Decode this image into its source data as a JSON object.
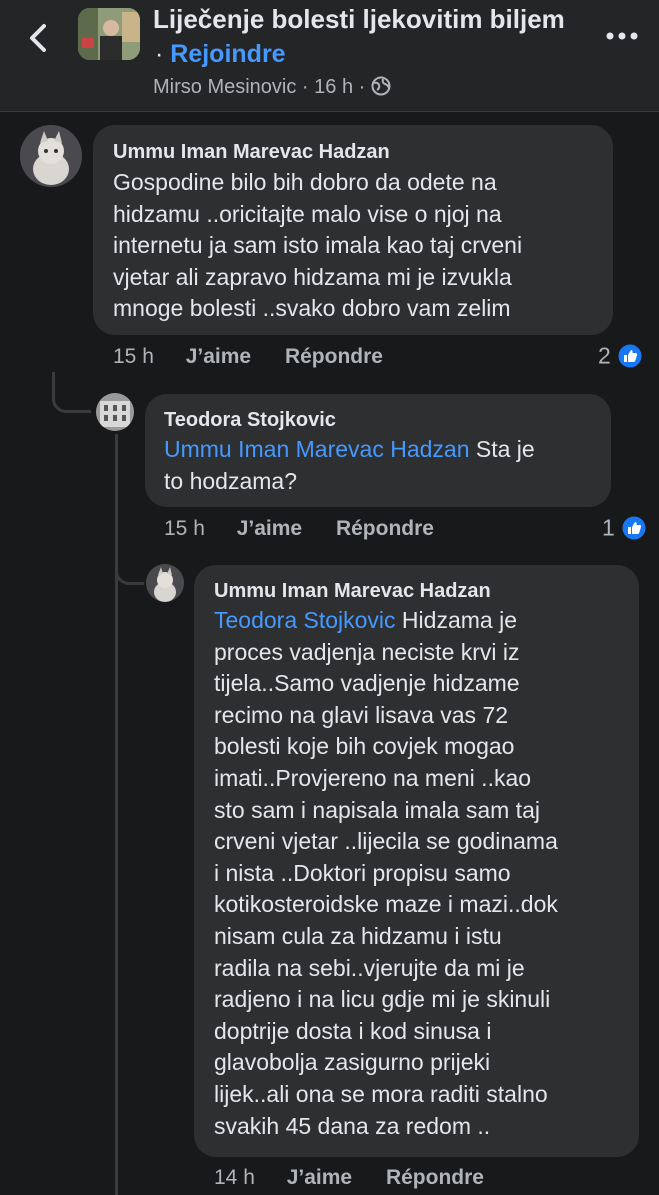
{
  "header": {
    "group_title": "Liječenje bolesti ljekovitim biljem",
    "separator": "·",
    "join_label": "Rejoindre",
    "author": "Mirso Mesinovic",
    "time": "16 h",
    "meta_sep": "·"
  },
  "comments": [
    {
      "author": "Ummu Iman Marevac Hadzan",
      "lines": [
        "Gospodine bilo bih dobro da odete na",
        "hidzamu ..oricitajte malo vise o njoj na",
        "internetu ja sam isto imala kao taj crveni",
        "vjetar ali zapravo hidzama mi je izvukla",
        "mnoge bolesti ..svako dobro vam zelim"
      ],
      "time": "15 h",
      "like_label": "J’aime",
      "reply_label": "Répondre",
      "reaction_count": "2"
    },
    {
      "author": "Teodora Stojkovic",
      "mention": "Ummu Iman Marevac Hadzan",
      "first_line_rest": " Sta je",
      "lines": [
        "to hodzama?"
      ],
      "time": "15 h",
      "like_label": "J’aime",
      "reply_label": "Répondre",
      "reaction_count": "1"
    },
    {
      "author": "Ummu Iman Marevac Hadzan",
      "mention": "Teodora Stojkovic",
      "first_line_rest": " Hidzama je",
      "lines": [
        "proces vadjenja neciste krvi iz",
        "tijela..Samo vadjenje hidzame",
        "recimo na glavi lisava vas 72",
        "bolesti koje bih covjek mogao",
        "imati..Provjereno na meni ..kao",
        "sto sam i napisala imala sam taj",
        "crveni vjetar ..lijecila se godinama",
        "i nista ..Doktori propisu samo",
        "kotikosteroidske maze i mazi..dok",
        "nisam cula za hidzamu i istu",
        "radila na sebi..vjerujte da mi je",
        "radjeno i na licu gdje mi je skinuli",
        "doptrije dosta i kod sinusa i",
        "glavobolja zasigurno prijeki",
        "lijek..ali ona se mora raditi stalno",
        "svakih 45 dana  za redom .."
      ],
      "time": "14 h",
      "like_label": "J’aime",
      "reply_label": "Répondre"
    }
  ],
  "colors": {
    "background": "#18191a",
    "bubble": "#2e2f31",
    "mention": "#4599ff",
    "like_badge": "#1877f2"
  }
}
